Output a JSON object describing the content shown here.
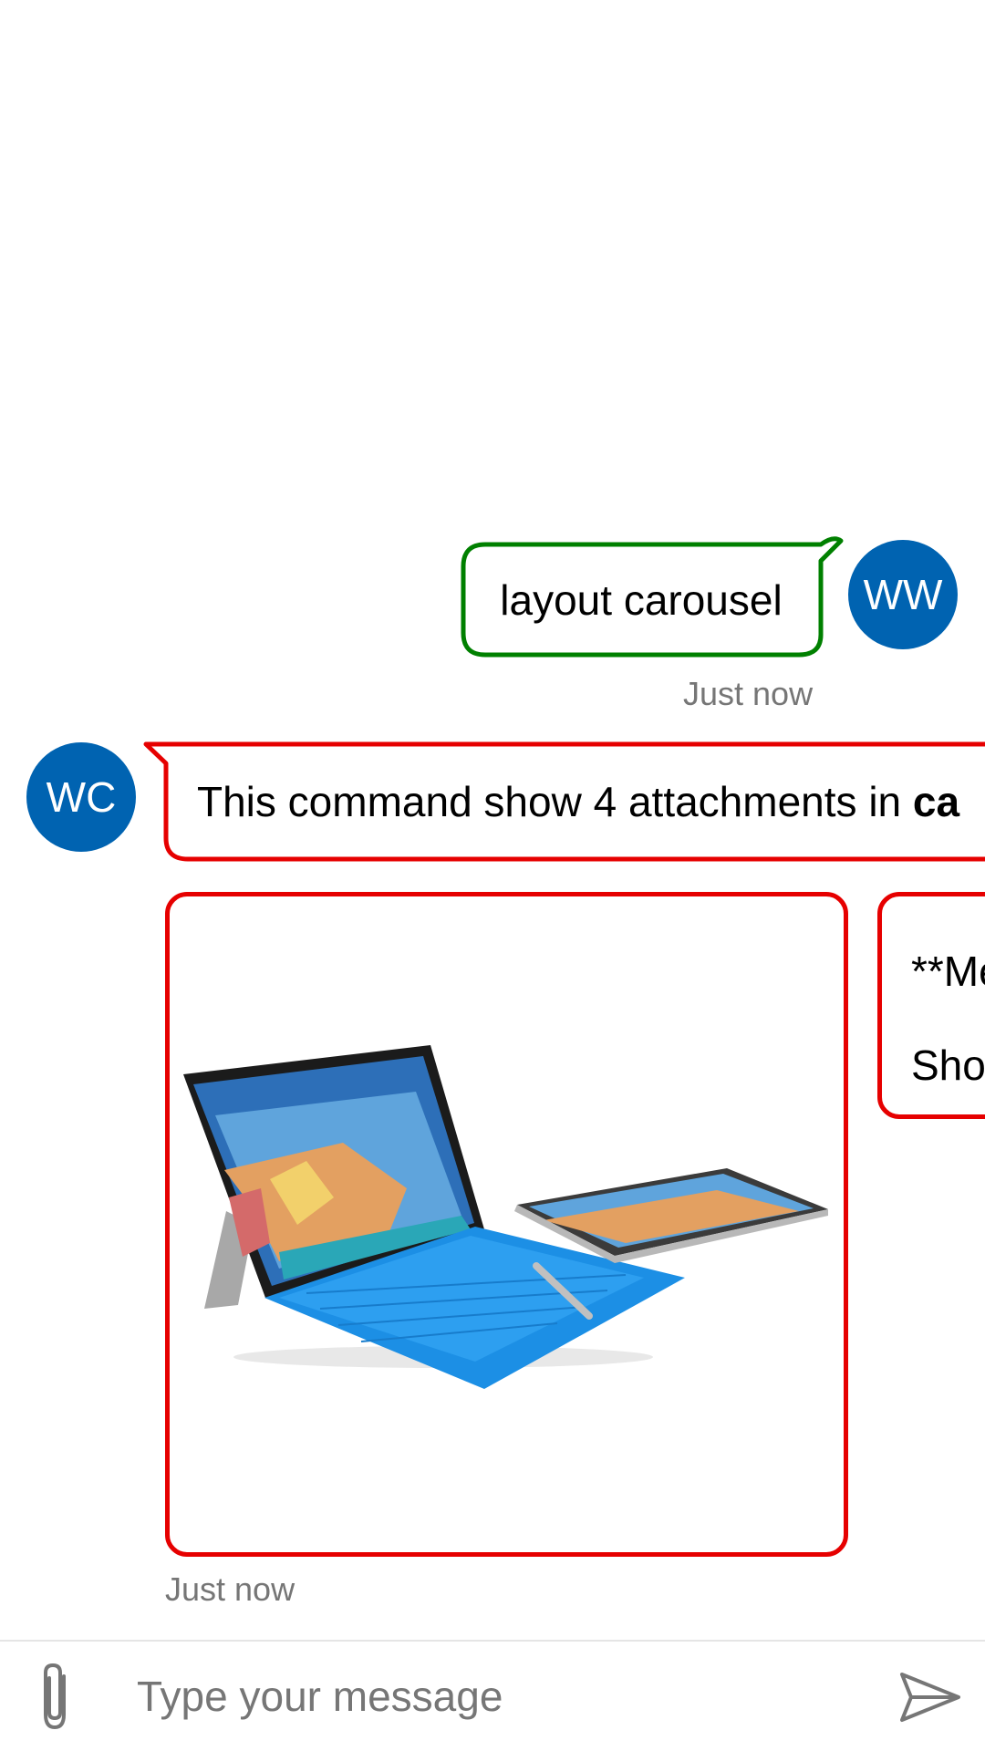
{
  "colors": {
    "accent": "#0063b1",
    "user_bubble_border": "#008000",
    "bot_bubble_border": "#e60000",
    "timestamp": "#767676"
  },
  "messages": {
    "user": {
      "avatar_initials": "WW",
      "text": "layout carousel",
      "timestamp": "Just now"
    },
    "bot": {
      "avatar_initials": "WC",
      "text_prefix": "This command show 4 attachments in ",
      "text_bold": "ca",
      "timestamp": "Just now"
    }
  },
  "carousel": {
    "cards": [
      {
        "type": "image",
        "image_icon": "laptop-tablet-product-image"
      },
      {
        "type": "text",
        "line1": "**Me",
        "line2": "Sho"
      }
    ]
  },
  "compose": {
    "placeholder": "Type your message",
    "value": "",
    "attach_icon": "paperclip-icon",
    "send_icon": "send-icon"
  }
}
